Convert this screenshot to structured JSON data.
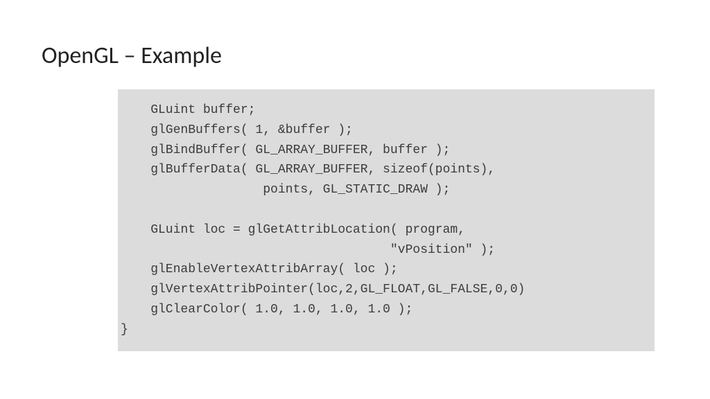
{
  "title": "OpenGL – Example",
  "code": "    GLuint buffer;\n    glGenBuffers( 1, &buffer );\n    glBindBuffer( GL_ARRAY_BUFFER, buffer );\n    glBufferData( GL_ARRAY_BUFFER, sizeof(points),\n                   points, GL_STATIC_DRAW );\n\n    GLuint loc = glGetAttribLocation( program,\n                                    \"vPosition\" );\n    glEnableVertexAttribArray( loc );\n    glVertexAttribPointer(loc,2,GL_FLOAT,GL_FALSE,0,0)\n    glClearColor( 1.0, 1.0, 1.0, 1.0 );\n}"
}
